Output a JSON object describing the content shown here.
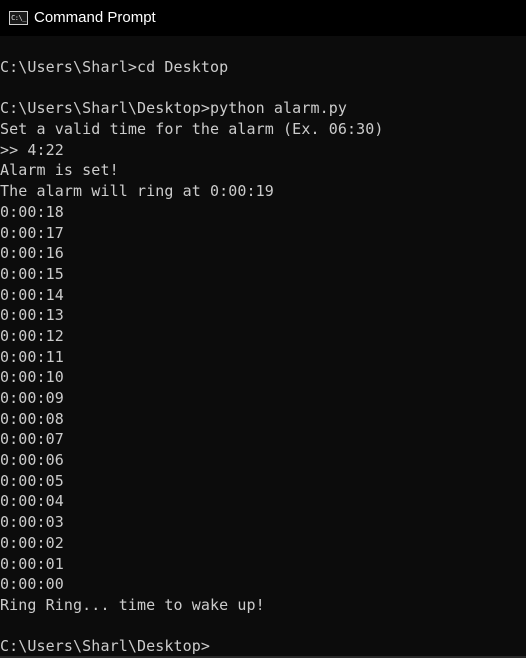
{
  "window": {
    "title": "Command Prompt",
    "icon": "cmd-icon",
    "icon_glyph": "C:\\_",
    "colors": {
      "background": "#0c0c0c",
      "titlebar": "#000000",
      "text": "#cccccc",
      "title_text": "#ffffff"
    }
  },
  "console": {
    "lines": [
      "C:\\Users\\Sharl>cd Desktop",
      "",
      "C:\\Users\\Sharl\\Desktop>python alarm.py",
      "Set a valid time for the alarm (Ex. 06:30)",
      ">> 4:22",
      "Alarm is set!",
      "The alarm will ring at 0:00:19",
      "0:00:18",
      "0:00:17",
      "0:00:16",
      "0:00:15",
      "0:00:14",
      "0:00:13",
      "0:00:12",
      "0:00:11",
      "0:00:10",
      "0:00:09",
      "0:00:08",
      "0:00:07",
      "0:00:06",
      "0:00:05",
      "0:00:04",
      "0:00:03",
      "0:00:02",
      "0:00:01",
      "0:00:00",
      "Ring Ring... time to wake up!",
      "",
      "C:\\Users\\Sharl\\Desktop>"
    ]
  }
}
